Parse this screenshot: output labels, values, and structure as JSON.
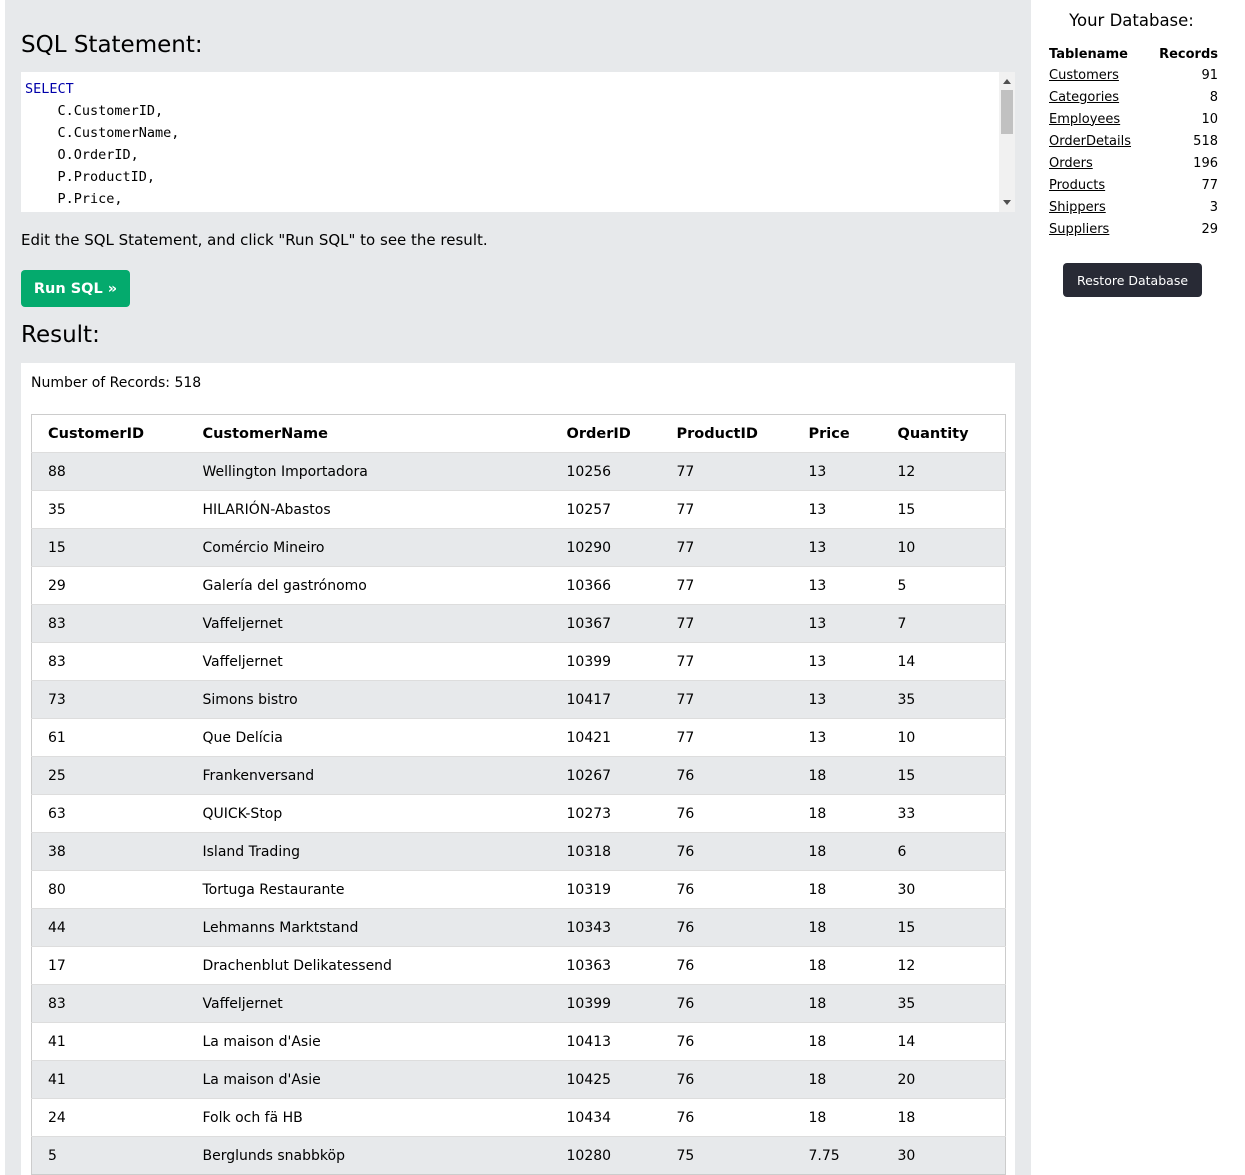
{
  "editor": {
    "title": "SQL Statement:",
    "code_lines": [
      {
        "text": "SELECT",
        "keyword": true
      },
      {
        "text": "    C.CustomerID,",
        "keyword": false
      },
      {
        "text": "    C.CustomerName,",
        "keyword": false
      },
      {
        "text": "    O.OrderID,",
        "keyword": false
      },
      {
        "text": "    P.ProductID,",
        "keyword": false
      },
      {
        "text": "    P.Price,",
        "keyword": false
      }
    ],
    "instructions": "Edit the SQL Statement, and click \"Run SQL\" to see the result.",
    "run_button_label": "Run SQL »"
  },
  "result": {
    "title": "Result:",
    "record_count_text": "Number of Records: 518",
    "columns": [
      "CustomerID",
      "CustomerName",
      "OrderID",
      "ProductID",
      "Price",
      "Quantity"
    ],
    "rows": [
      [
        "88",
        "Wellington Importadora",
        "10256",
        "77",
        "13",
        "12"
      ],
      [
        "35",
        "HILARIÓN-Abastos",
        "10257",
        "77",
        "13",
        "15"
      ],
      [
        "15",
        "Comércio Mineiro",
        "10290",
        "77",
        "13",
        "10"
      ],
      [
        "29",
        "Galería del gastrónomo",
        "10366",
        "77",
        "13",
        "5"
      ],
      [
        "83",
        "Vaffeljernet",
        "10367",
        "77",
        "13",
        "7"
      ],
      [
        "83",
        "Vaffeljernet",
        "10399",
        "77",
        "13",
        "14"
      ],
      [
        "73",
        "Simons bistro",
        "10417",
        "77",
        "13",
        "35"
      ],
      [
        "61",
        "Que Delícia",
        "10421",
        "77",
        "13",
        "10"
      ],
      [
        "25",
        "Frankenversand",
        "10267",
        "76",
        "18",
        "15"
      ],
      [
        "63",
        "QUICK-Stop",
        "10273",
        "76",
        "18",
        "33"
      ],
      [
        "38",
        "Island Trading",
        "10318",
        "76",
        "18",
        "6"
      ],
      [
        "80",
        "Tortuga Restaurante",
        "10319",
        "76",
        "18",
        "30"
      ],
      [
        "44",
        "Lehmanns Marktstand",
        "10343",
        "76",
        "18",
        "15"
      ],
      [
        "17",
        "Drachenblut Delikatessend",
        "10363",
        "76",
        "18",
        "12"
      ],
      [
        "83",
        "Vaffeljernet",
        "10399",
        "76",
        "18",
        "35"
      ],
      [
        "41",
        "La maison d'Asie",
        "10413",
        "76",
        "18",
        "14"
      ],
      [
        "41",
        "La maison d'Asie",
        "10425",
        "76",
        "18",
        "20"
      ],
      [
        "24",
        "Folk och fä HB",
        "10434",
        "76",
        "18",
        "18"
      ],
      [
        "5",
        "Berglunds snabbköp",
        "10280",
        "75",
        "7.75",
        "30"
      ]
    ]
  },
  "database": {
    "title": "Your Database:",
    "header_tablename": "Tablename",
    "header_records": "Records",
    "tables": [
      {
        "name": "Customers",
        "records": "91"
      },
      {
        "name": "Categories",
        "records": "8"
      },
      {
        "name": "Employees",
        "records": "10"
      },
      {
        "name": "OrderDetails",
        "records": "518"
      },
      {
        "name": "Orders",
        "records": "196"
      },
      {
        "name": "Products",
        "records": "77"
      },
      {
        "name": "Shippers",
        "records": "3"
      },
      {
        "name": "Suppliers",
        "records": "29"
      }
    ],
    "restore_button_label": "Restore Database"
  },
  "colors": {
    "run_button": "#04aa6d",
    "restore_button": "#282a35",
    "panel_background": "#e7e9eb",
    "sql_keyword": "#0000aa"
  }
}
